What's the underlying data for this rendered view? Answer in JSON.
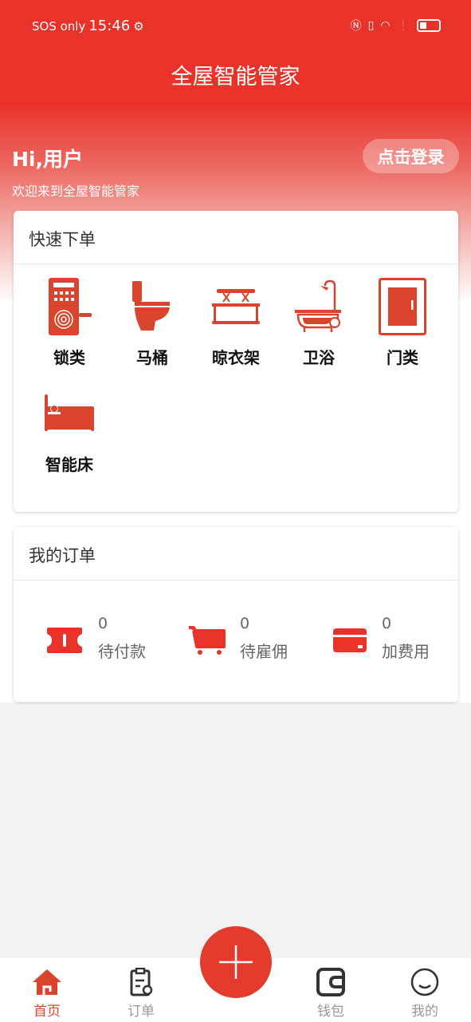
{
  "status_bar": {
    "carrier": "SOS only",
    "time": "15:46",
    "icons": [
      "gear-icon",
      "nfc-icon",
      "vibrate-icon",
      "wifi-icon",
      "alert-icon",
      "battery-icon"
    ]
  },
  "header": {
    "title": "全屋智能管家",
    "greeting": "Hi,用户",
    "welcome": "欢迎来到全屋智能管家",
    "login_label": "点击登录"
  },
  "quick_order": {
    "title": "快速下单",
    "items": [
      {
        "label": "锁类",
        "icon": "smart-lock-icon"
      },
      {
        "label": "马桶",
        "icon": "toilet-icon"
      },
      {
        "label": "晾衣架",
        "icon": "clothes-rack-icon"
      },
      {
        "label": "卫浴",
        "icon": "bathtub-icon"
      },
      {
        "label": "门类",
        "icon": "door-icon"
      },
      {
        "label": "智能床",
        "icon": "bed-icon"
      }
    ]
  },
  "my_orders": {
    "title": "我的订单",
    "items": [
      {
        "count": "0",
        "label": "待付款",
        "icon": "ticket-icon"
      },
      {
        "count": "0",
        "label": "待雇佣",
        "icon": "cart-icon"
      },
      {
        "count": "0",
        "label": "加费用",
        "icon": "card-icon"
      }
    ]
  },
  "tabbar": {
    "items": [
      {
        "label": "首页",
        "active": true
      },
      {
        "label": "订单"
      },
      {
        "label": "钱包"
      },
      {
        "label": "我的"
      }
    ]
  },
  "colors": {
    "brand": "#e8322a",
    "icon": "#d9452c",
    "tab_inactive": "#999999"
  }
}
